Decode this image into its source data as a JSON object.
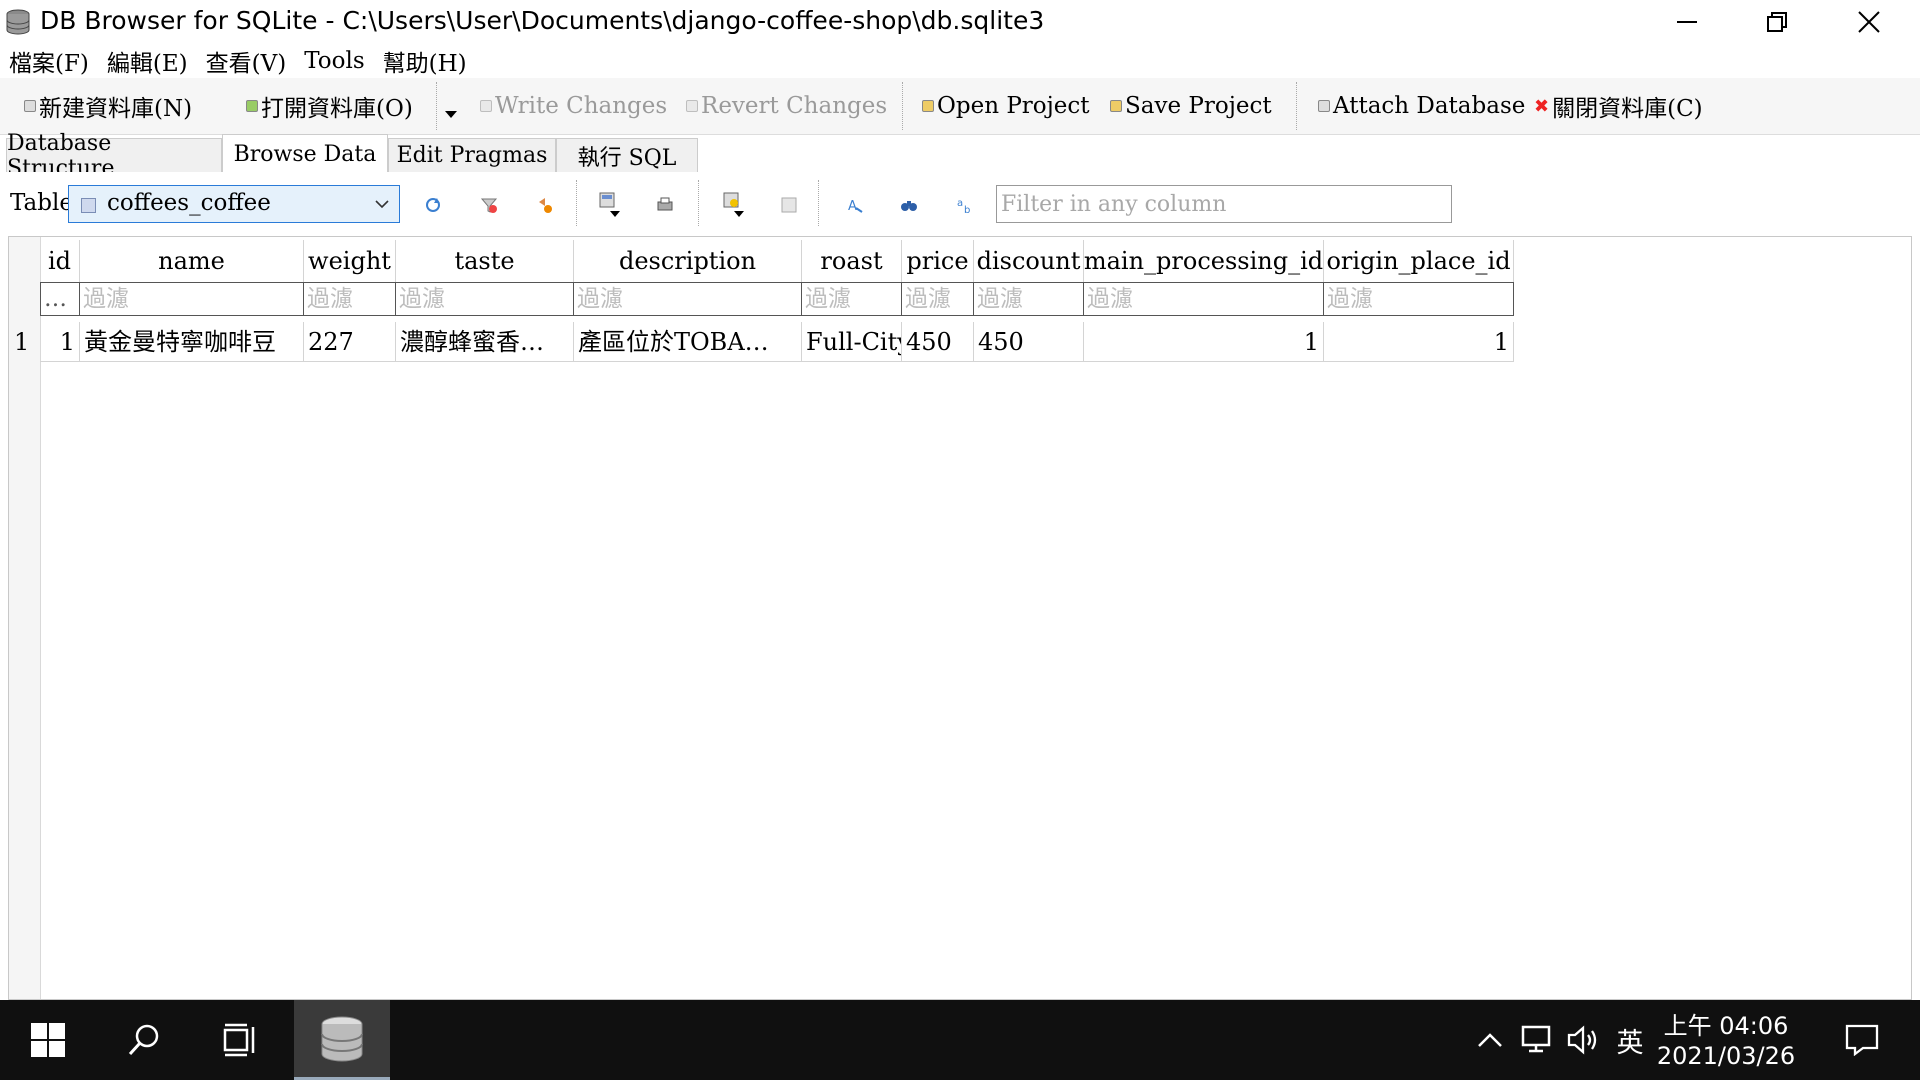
{
  "window": {
    "title": "DB Browser for SQLite - C:\\Users\\User\\Documents\\django-coffee-shop\\db.sqlite3",
    "controls": [
      "minimize-icon",
      "restore-icon",
      "close-icon"
    ]
  },
  "menu": [
    "檔案(F)",
    "編輯(E)",
    "查看(V)",
    "Tools",
    "幫助(H)"
  ],
  "toolbar": {
    "new_db": "新建資料庫(N)",
    "open_db": "打開資料庫(O)",
    "write_changes": "Write Changes",
    "revert_changes": "Revert Changes",
    "open_project": "Open Project",
    "save_project": "Save Project",
    "attach_db": "Attach Database",
    "close_db": "關閉資料庫(C)"
  },
  "tabs": [
    {
      "label": "Database Structure",
      "active": false
    },
    {
      "label": "Browse Data",
      "active": true
    },
    {
      "label": "Edit Pragmas",
      "active": false
    },
    {
      "label": "執行 SQL",
      "active": false
    }
  ],
  "browse": {
    "table_label": "Table:",
    "selected_table": "coffees_coffee",
    "filter_placeholder": "Filter in any column"
  },
  "grid": {
    "columns": [
      "id",
      "name",
      "weight",
      "taste",
      "description",
      "roast",
      "price",
      "discount",
      "main_processing_id",
      "origin_place_id"
    ],
    "filter_placeholder": "過濾",
    "id_filter_placeholder": "…",
    "rows": [
      {
        "row_number": "1",
        "cells": [
          "1",
          "黃金曼特寧咖啡豆",
          "227",
          "濃醇蜂蜜香…",
          "產區位於TOBA…",
          "Full-City",
          "450",
          "450",
          "1",
          "1"
        ]
      }
    ]
  },
  "taskbar": {
    "time": "上午 04:06",
    "date": "2021/03/26",
    "ime": "英",
    "colors": {
      "background": "#101010",
      "active_app": "#3a3a3a"
    }
  }
}
